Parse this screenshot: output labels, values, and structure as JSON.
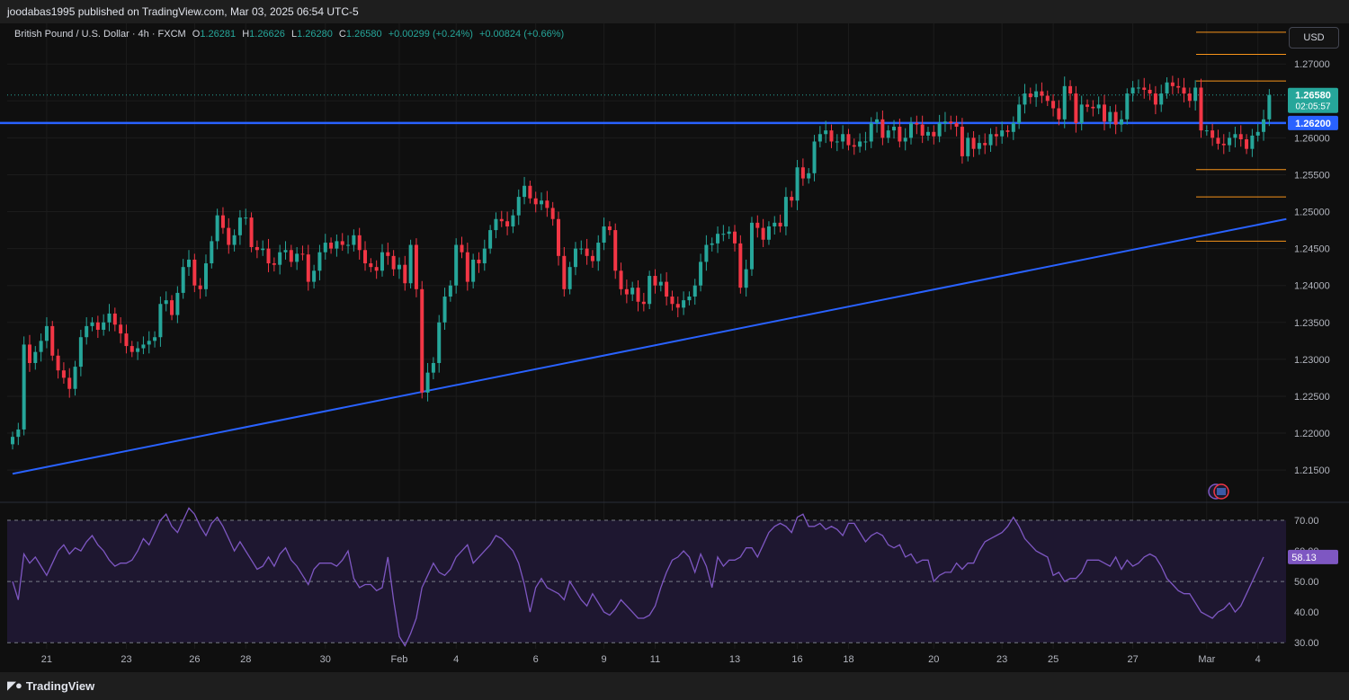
{
  "header": {
    "publisher_text": "joodabas1995 published on TradingView.com, Mar 03, 2025 06:54 UTC-5"
  },
  "legend": {
    "symbol": "British Pound / U.S. Dollar · 4h · FXCM",
    "o_label": "O",
    "o_value": "1.26281",
    "h_label": "H",
    "h_value": "1.26626",
    "l_label": "L",
    "l_value": "1.26280",
    "c_label": "C",
    "c_value": "1.26580",
    "change": "+0.00299 (+0.24%)",
    "volume_change": "+0.00824 (+0.66%)"
  },
  "currency_label": "USD",
  "footer": {
    "brand": "TradingView",
    "logo_icon": "tradingview-logo-icon"
  },
  "colors": {
    "up": "#26a69a",
    "down": "#f23645",
    "trendline": "#2962ff",
    "level_line": "#f7931a",
    "rsi_line": "#7e57c2",
    "rsi_band": "#1e1730",
    "price_badge": "#26a69a",
    "support_badge": "#2962ff"
  },
  "chart_data": [
    {
      "type": "candlestick",
      "title": "British Pound / U.S. Dollar · 4h · FXCM",
      "ylim": [
        1.211,
        1.2755
      ],
      "y_ticks": [
        1.215,
        1.22,
        1.225,
        1.23,
        1.235,
        1.24,
        1.245,
        1.25,
        1.255,
        1.26,
        1.265,
        1.27
      ],
      "y_tick_labels": [
        "1.21500",
        "1.22000",
        "1.22500",
        "1.23000",
        "1.23500",
        "1.24000",
        "1.24500",
        "1.25000",
        "1.25500",
        "1.26000",
        "1.26500",
        "1.27000"
      ],
      "x_ticks": [
        {
          "label": "21",
          "bar": 6
        },
        {
          "label": "23",
          "bar": 20
        },
        {
          "label": "26",
          "bar": 32
        },
        {
          "label": "28",
          "bar": 41
        },
        {
          "label": "30",
          "bar": 55
        },
        {
          "label": "Feb",
          "bar": 68
        },
        {
          "label": "4",
          "bar": 78
        },
        {
          "label": "6",
          "bar": 92
        },
        {
          "label": "9",
          "bar": 104
        },
        {
          "label": "11",
          "bar": 113
        },
        {
          "label": "13",
          "bar": 127
        },
        {
          "label": "16",
          "bar": 138
        },
        {
          "label": "18",
          "bar": 147
        },
        {
          "label": "20",
          "bar": 162
        },
        {
          "label": "23",
          "bar": 174
        },
        {
          "label": "25",
          "bar": 183
        },
        {
          "label": "27",
          "bar": 197
        },
        {
          "label": "Mar",
          "bar": 210
        },
        {
          "label": "4",
          "bar": 219
        }
      ],
      "bars_total": 224,
      "close": [
        1.2195,
        1.2205,
        1.232,
        1.2295,
        1.231,
        1.2325,
        1.2345,
        1.2305,
        1.2285,
        1.2275,
        1.226,
        1.229,
        1.233,
        1.2345,
        1.235,
        1.234,
        1.235,
        1.2362,
        1.2347,
        1.2335,
        1.2318,
        1.231,
        1.2315,
        1.232,
        1.2325,
        1.233,
        1.2375,
        1.238,
        1.236,
        1.239,
        1.2425,
        1.2435,
        1.24,
        1.2395,
        1.243,
        1.246,
        1.2495,
        1.2478,
        1.2455,
        1.2468,
        1.2492,
        1.2492,
        1.2452,
        1.2448,
        1.245,
        1.243,
        1.2428,
        1.2445,
        1.2448,
        1.2432,
        1.2443,
        1.2442,
        1.2405,
        1.242,
        1.2445,
        1.2458,
        1.245,
        1.246,
        1.2455,
        1.2455,
        1.2468,
        1.2448,
        1.243,
        1.2425,
        1.242,
        1.2445,
        1.244,
        1.2422,
        1.2428,
        1.2403,
        1.2455,
        1.2395,
        1.2255,
        1.2282,
        1.2295,
        1.235,
        1.2385,
        1.24,
        1.2455,
        1.2445,
        1.2405,
        1.2435,
        1.243,
        1.245,
        1.2475,
        1.249,
        1.2487,
        1.248,
        1.2495,
        1.252,
        1.2535,
        1.2518,
        1.251,
        1.2515,
        1.2505,
        1.249,
        1.244,
        1.2395,
        1.2425,
        1.245,
        1.245,
        1.244,
        1.2433,
        1.2458,
        1.248,
        1.2475,
        1.242,
        1.2395,
        1.2388,
        1.2397,
        1.2378,
        1.2375,
        1.2413,
        1.24,
        1.2405,
        1.2385,
        1.2375,
        1.237,
        1.238,
        1.2385,
        1.24,
        1.2432,
        1.2455,
        1.2457,
        1.247,
        1.247,
        1.2473,
        1.2457,
        1.2397,
        1.2422,
        1.2485,
        1.2478,
        1.2462,
        1.248,
        1.2485,
        1.248,
        1.252,
        1.2515,
        1.256,
        1.2545,
        1.2552,
        1.2595,
        1.2605,
        1.261,
        1.2595,
        1.2595,
        1.2605,
        1.259,
        1.2588,
        1.2595,
        1.2595,
        1.262,
        1.2625,
        1.26,
        1.261,
        1.2615,
        1.2595,
        1.26,
        1.262,
        1.2618,
        1.2603,
        1.2608,
        1.2602,
        1.262,
        1.2622,
        1.262,
        1.2615,
        1.2575,
        1.26,
        1.2585,
        1.2593,
        1.259,
        1.2605,
        1.2602,
        1.261,
        1.2608,
        1.262,
        1.2645,
        1.266,
        1.2655,
        1.2663,
        1.2657,
        1.265,
        1.264,
        1.2625,
        1.267,
        1.266,
        1.262,
        1.2645,
        1.2642,
        1.264,
        1.2645,
        1.2622,
        1.2635,
        1.2618,
        1.2625,
        1.266,
        1.2668,
        1.2668,
        1.2665,
        1.266,
        1.2645,
        1.266,
        1.2675,
        1.267,
        1.2668,
        1.266,
        1.265,
        1.2668,
        1.261,
        1.261,
        1.26,
        1.2592,
        1.259,
        1.26,
        1.2605,
        1.2598,
        1.2585,
        1.2603,
        1.2608,
        1.2625,
        1.2658
      ],
      "last_price": "1.26580",
      "countdown": "02:05:57",
      "support_level": 1.262,
      "support_label": "1.26200",
      "levels": [
        1.2743,
        1.2713,
        1.2677,
        1.2557,
        1.252,
        1.246
      ],
      "trendline": [
        {
          "bar": 0,
          "price": 1.2145
        },
        {
          "bar": 224,
          "price": 1.249
        }
      ]
    },
    {
      "type": "line",
      "title": "",
      "ylim": [
        28,
        75
      ],
      "y_ticks": [
        30,
        40,
        50,
        60,
        70
      ],
      "y_tick_labels": [
        "30.00",
        "40.00",
        "50.00",
        "60.00",
        "70.00"
      ],
      "band": [
        30,
        70
      ],
      "last_value": "58.13",
      "values": [
        50,
        44,
        59,
        56,
        58,
        55,
        52,
        56,
        60,
        62,
        59,
        61,
        60,
        63,
        65,
        62,
        60,
        57,
        55,
        56,
        56,
        57,
        60,
        64,
        62,
        66,
        70,
        72,
        68,
        66,
        70,
        74,
        72,
        68,
        65,
        69,
        71,
        68,
        64,
        60,
        63,
        60,
        57,
        54,
        55,
        58,
        55,
        59,
        61,
        57,
        55,
        52,
        49,
        54,
        56,
        56,
        56,
        55,
        57,
        60,
        51,
        48,
        49,
        49,
        47,
        48,
        58,
        44,
        32,
        29,
        33,
        38,
        48,
        52,
        56,
        53,
        52,
        54,
        58,
        60,
        62,
        56,
        58,
        60,
        62,
        65,
        64,
        62,
        60,
        56,
        49,
        40,
        48,
        51,
        48,
        47,
        46,
        44,
        50,
        47,
        44,
        42,
        46,
        43,
        40,
        39,
        41,
        44,
        42,
        40,
        38,
        38,
        39,
        42,
        48,
        53,
        57,
        58,
        60,
        58,
        53,
        59,
        55,
        48,
        58,
        55,
        57,
        57,
        58,
        61,
        61,
        58,
        62,
        66,
        68,
        69,
        68,
        66,
        71,
        72,
        68,
        68,
        69,
        67,
        68,
        67,
        65,
        69,
        69,
        66,
        63,
        65,
        66,
        65,
        62,
        61,
        62,
        58,
        59,
        56,
        57,
        57,
        50,
        52,
        53,
        53,
        56,
        54,
        56,
        56,
        60,
        63,
        64,
        65,
        66,
        68,
        71,
        68,
        64,
        62,
        60,
        59,
        58,
        52,
        53,
        50,
        51,
        51,
        53,
        57,
        57,
        57,
        56,
        55,
        58,
        54,
        57,
        55,
        56,
        58,
        59,
        58,
        55,
        51,
        49,
        47,
        46,
        46,
        43,
        40,
        39,
        38,
        40,
        41,
        43,
        40,
        42,
        46,
        50,
        54,
        58
      ]
    }
  ]
}
